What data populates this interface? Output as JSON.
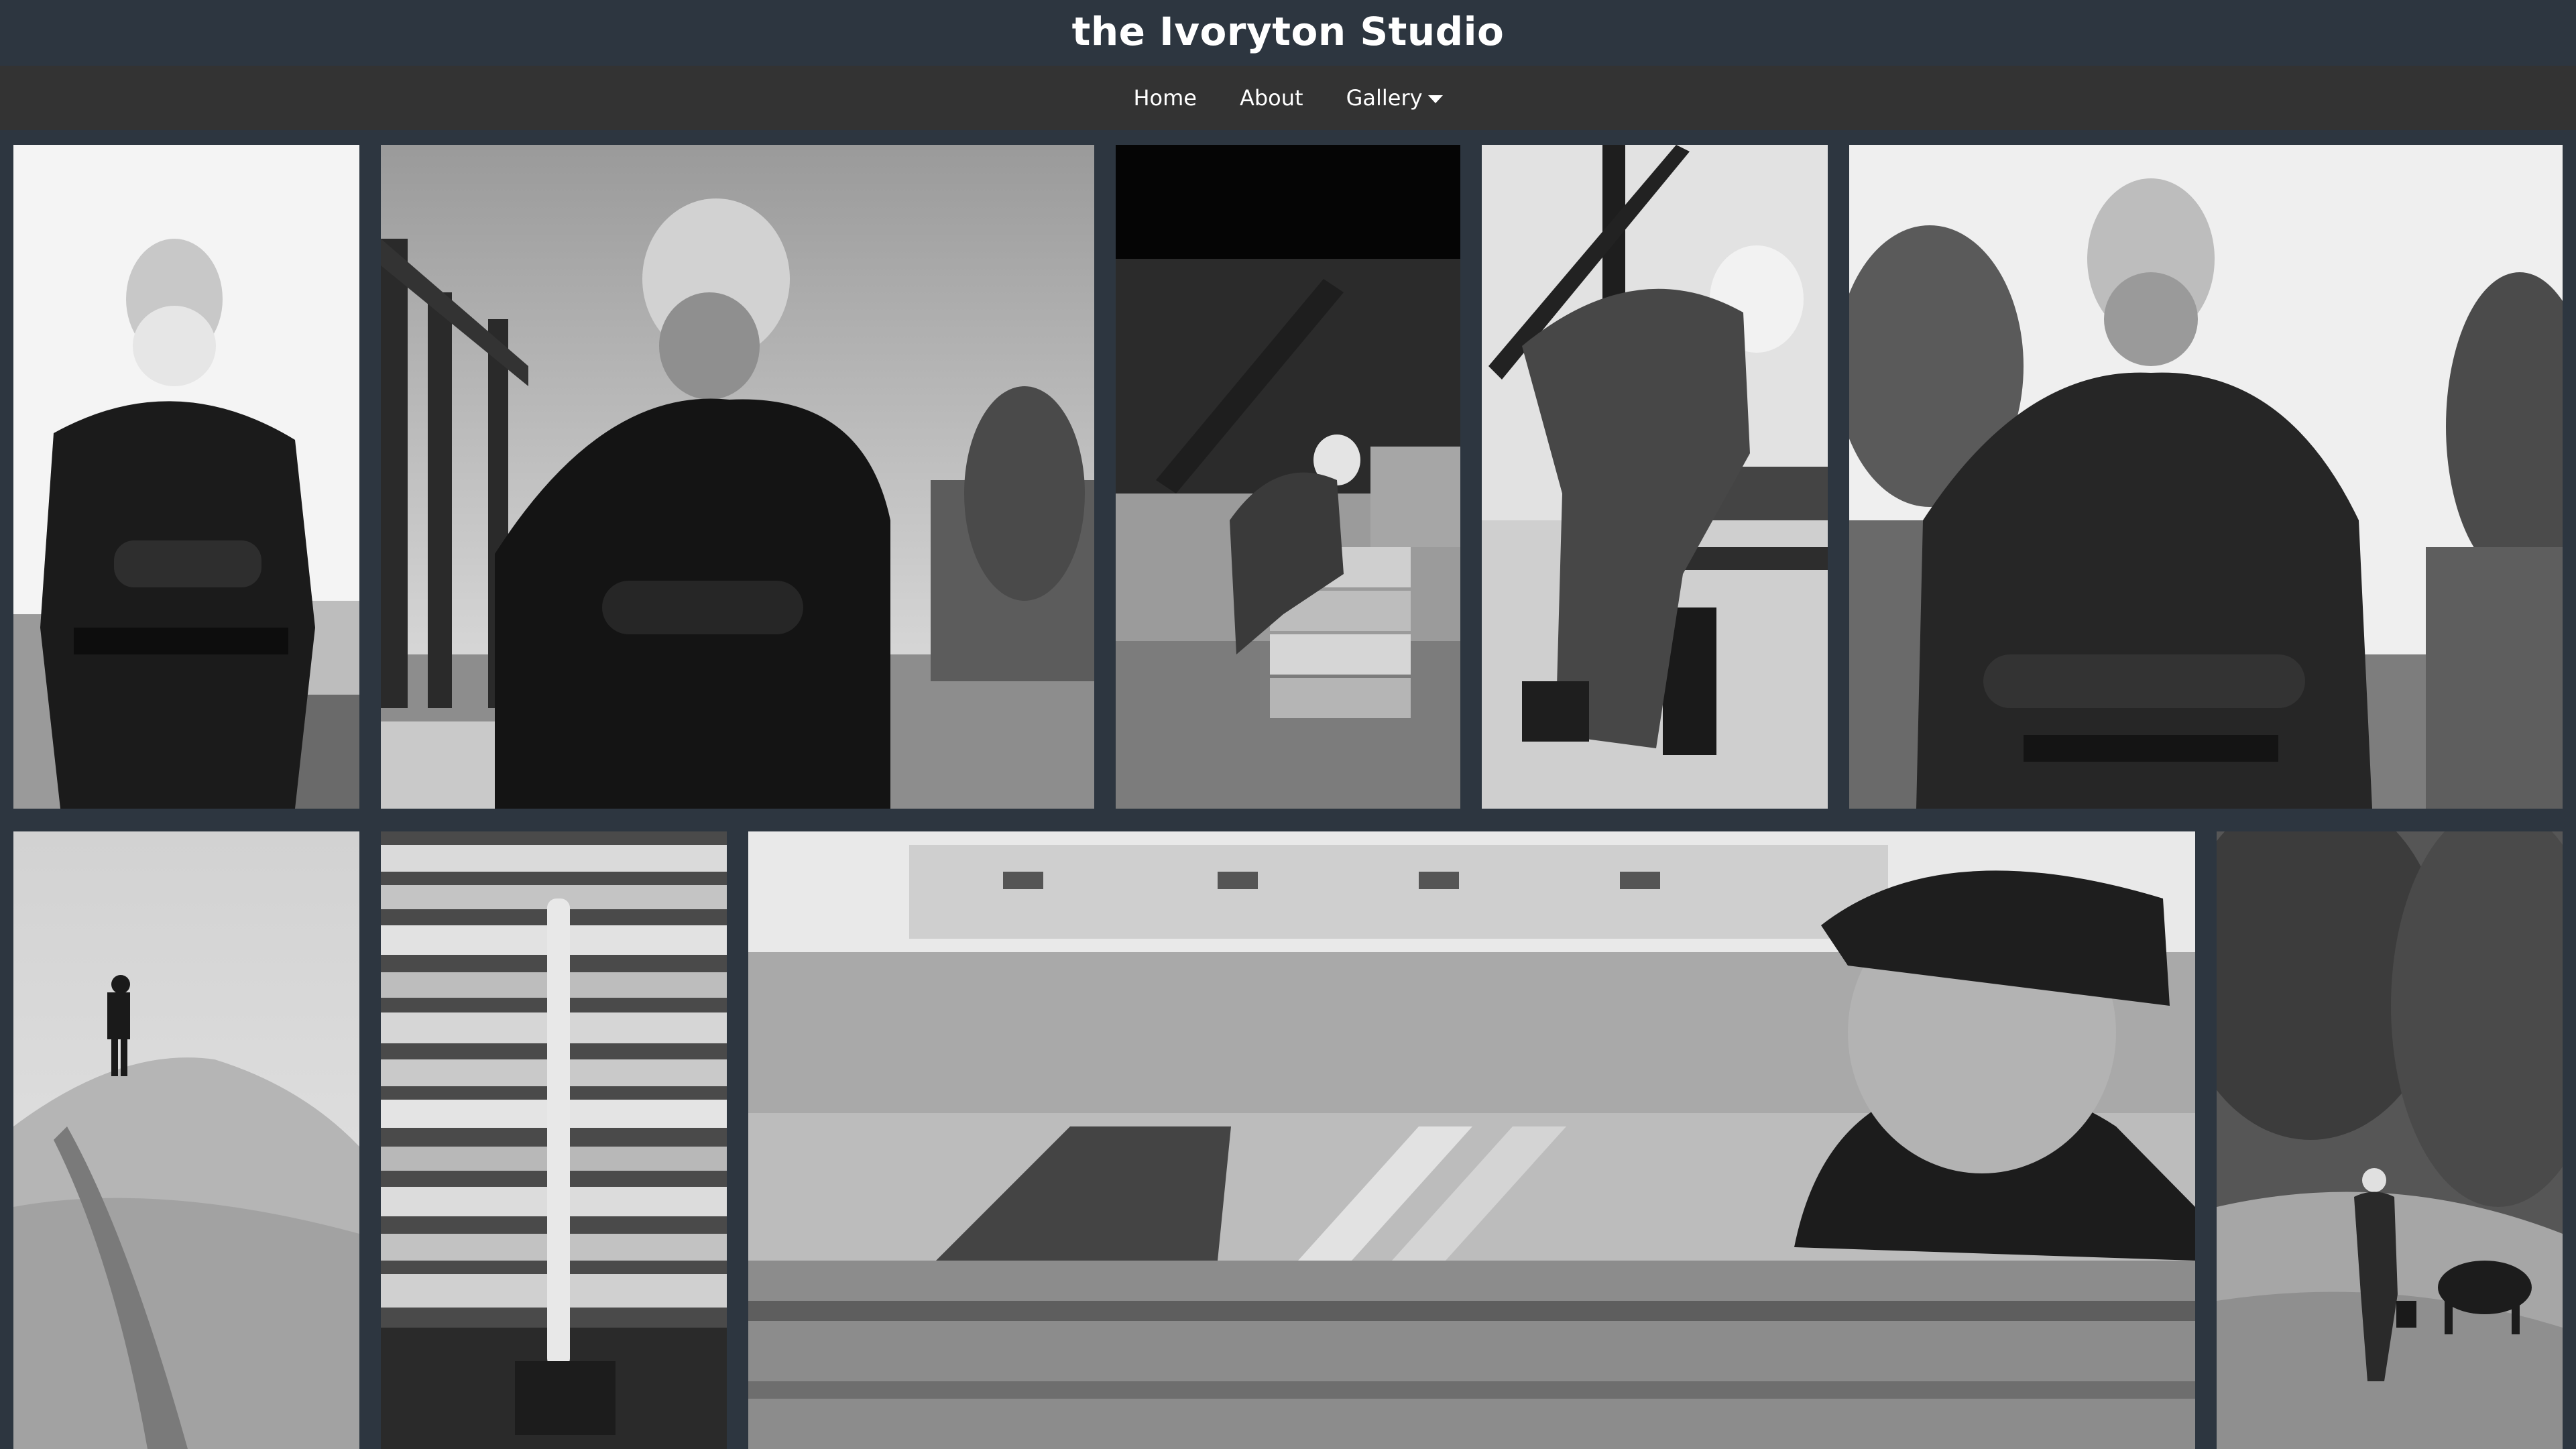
{
  "site": {
    "title": "the Ivoryton Studio"
  },
  "nav": {
    "home": "Home",
    "about": "About",
    "gallery": "Gallery"
  },
  "gallery": {
    "photos": [
      {
        "subject": "bearded old man with arms crossed, white sky"
      },
      {
        "subject": "old man with arms crossed by wooden frame structure"
      },
      {
        "subject": "man working under shed with lumber"
      },
      {
        "subject": "man bending over sawing wood"
      },
      {
        "subject": "old man with arms crossed in field"
      },
      {
        "subject": "figure standing on top of sawdust pile"
      },
      {
        "subject": "axe leaning against stacked boards"
      },
      {
        "subject": "old man in cap looking over wooden planks"
      },
      {
        "subject": "man walking down hill with cow"
      }
    ]
  },
  "colors": {
    "header_bg": "#2d3640",
    "nav_bg": "#333333",
    "text": "#ffffff"
  }
}
